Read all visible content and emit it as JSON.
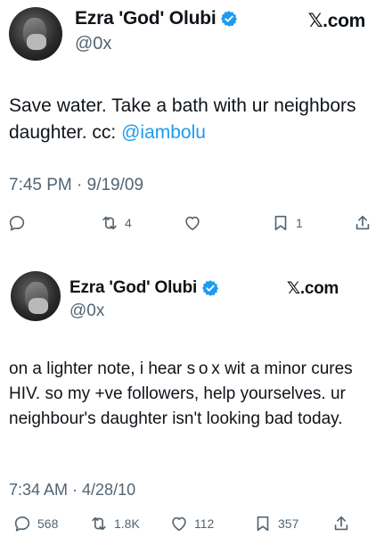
{
  "tweets": [
    {
      "display_name": "Ezra 'God' Olubi",
      "handle": "@0x",
      "source": "𝕏.com",
      "text_before": "Save water. Take a bath with ur neighbors daughter. cc: ",
      "mention": "@iambolu",
      "timestamp": "7:45 PM · 9/19/09",
      "replies": "",
      "retweets": "4",
      "likes": "",
      "bookmarks": "1"
    },
    {
      "display_name": "Ezra 'God' Olubi",
      "handle": "@0x",
      "source": "𝕏.com",
      "text": "on a lighter note, i hear s o x wit a minor cures HIV. so my +ve followers, help yourselves. ur neighbour's daughter isn't looking bad today.",
      "timestamp": "7:34 AM · 4/28/10",
      "replies": "568",
      "retweets": "1.8K",
      "likes": "112",
      "bookmarks": "357"
    }
  ],
  "icons": {
    "reply": "reply-icon",
    "retweet": "retweet-icon",
    "like": "heart-icon",
    "bookmark": "bookmark-icon",
    "share": "share-icon",
    "verified": "verified-badge-icon"
  },
  "colors": {
    "accent": "#1d9bf0",
    "secondary_text": "#536471",
    "primary_text": "#0f1419"
  }
}
